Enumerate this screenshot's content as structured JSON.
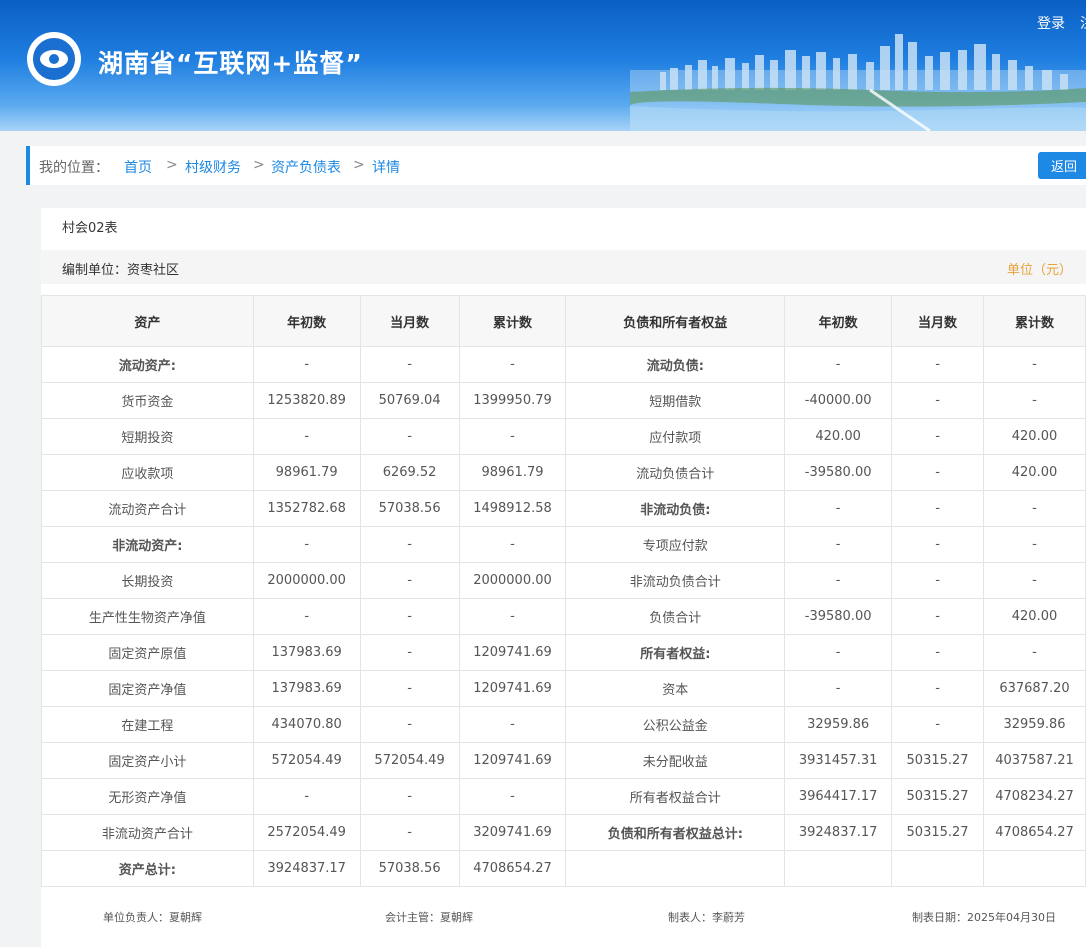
{
  "header": {
    "site_title": "湖南省“互联网+监督”",
    "login": "登录",
    "extra": "注"
  },
  "breadcrumb": {
    "label": "我的位置：",
    "items": [
      "首页",
      "村级财务",
      "资产负债表",
      "详情"
    ],
    "separator": ">"
  },
  "back_button": "返回",
  "report": {
    "form_code": "村会02表",
    "unit_name": "编制单位：资枣社区",
    "unit_label": "单位（元）"
  },
  "table": {
    "headers": [
      "资产",
      "年初数",
      "当月数",
      "累计数",
      "负债和所有者权益",
      "年初数",
      "当月数",
      "累计数"
    ],
    "rows": [
      {
        "a": "流动资产:",
        "ab": true,
        "a1": "-",
        "a2": "-",
        "a3": "-",
        "l": "流动负债:",
        "lb": true,
        "l1": "-",
        "l2": "-",
        "l3": "-"
      },
      {
        "a": "货币资金",
        "ab": false,
        "a1": "1253820.89",
        "a2": "50769.04",
        "a3": "1399950.79",
        "l": "短期借款",
        "lb": false,
        "l1": "-40000.00",
        "l2": "-",
        "l3": "-"
      },
      {
        "a": "短期投资",
        "ab": false,
        "a1": "-",
        "a2": "-",
        "a3": "-",
        "l": "应付款项",
        "lb": false,
        "l1": "420.00",
        "l2": "-",
        "l3": "420.00"
      },
      {
        "a": "应收款项",
        "ab": false,
        "a1": "98961.79",
        "a2": "6269.52",
        "a3": "98961.79",
        "l": "流动负债合计",
        "lb": false,
        "l1": "-39580.00",
        "l2": "-",
        "l3": "420.00"
      },
      {
        "a": "流动资产合计",
        "ab": false,
        "a1": "1352782.68",
        "a2": "57038.56",
        "a3": "1498912.58",
        "l": "非流动负债:",
        "lb": true,
        "l1": "-",
        "l2": "-",
        "l3": "-"
      },
      {
        "a": "非流动资产:",
        "ab": true,
        "a1": "-",
        "a2": "-",
        "a3": "-",
        "l": "专项应付款",
        "lb": false,
        "l1": "-",
        "l2": "-",
        "l3": "-"
      },
      {
        "a": "长期投资",
        "ab": false,
        "a1": "2000000.00",
        "a2": "-",
        "a3": "2000000.00",
        "l": "非流动负债合计",
        "lb": false,
        "l1": "-",
        "l2": "-",
        "l3": "-"
      },
      {
        "a": "生产性生物资产净值",
        "ab": false,
        "a1": "-",
        "a2": "-",
        "a3": "-",
        "l": "负债合计",
        "lb": false,
        "l1": "-39580.00",
        "l2": "-",
        "l3": "420.00"
      },
      {
        "a": "固定资产原值",
        "ab": false,
        "a1": "137983.69",
        "a2": "-",
        "a3": "1209741.69",
        "l": "所有者权益:",
        "lb": true,
        "l1": "-",
        "l2": "-",
        "l3": "-"
      },
      {
        "a": "固定资产净值",
        "ab": false,
        "a1": "137983.69",
        "a2": "-",
        "a3": "1209741.69",
        "l": "资本",
        "lb": false,
        "l1": "-",
        "l2": "-",
        "l3": "637687.20"
      },
      {
        "a": "在建工程",
        "ab": false,
        "a1": "434070.80",
        "a2": "-",
        "a3": "-",
        "l": "公积公益金",
        "lb": false,
        "l1": "32959.86",
        "l2": "-",
        "l3": "32959.86"
      },
      {
        "a": "固定资产小计",
        "ab": false,
        "a1": "572054.49",
        "a2": "572054.49",
        "a3": "1209741.69",
        "l": "未分配收益",
        "lb": false,
        "l1": "3931457.31",
        "l2": "50315.27",
        "l3": "4037587.21"
      },
      {
        "a": "无形资产净值",
        "ab": false,
        "a1": "-",
        "a2": "-",
        "a3": "-",
        "l": "所有者权益合计",
        "lb": false,
        "l1": "3964417.17",
        "l2": "50315.27",
        "l3": "4708234.27"
      },
      {
        "a": "非流动资产合计",
        "ab": false,
        "a1": "2572054.49",
        "a2": "-",
        "a3": "3209741.69",
        "l": "负债和所有者权益总计:",
        "lb": true,
        "l1": "3924837.17",
        "l2": "50315.27",
        "l3": "4708654.27"
      },
      {
        "a": "资产总计:",
        "ab": true,
        "a1": "3924837.17",
        "a2": "57038.56",
        "a3": "4708654.27",
        "l": "",
        "lb": false,
        "l1": "",
        "l2": "",
        "l3": ""
      }
    ]
  },
  "footer": {
    "leader": "单位负责人：夏朝辉",
    "accountant": "会计主管：夏朝辉",
    "preparer": "制表人：李蔚芳",
    "date": "制表日期：2025年04月30日"
  }
}
